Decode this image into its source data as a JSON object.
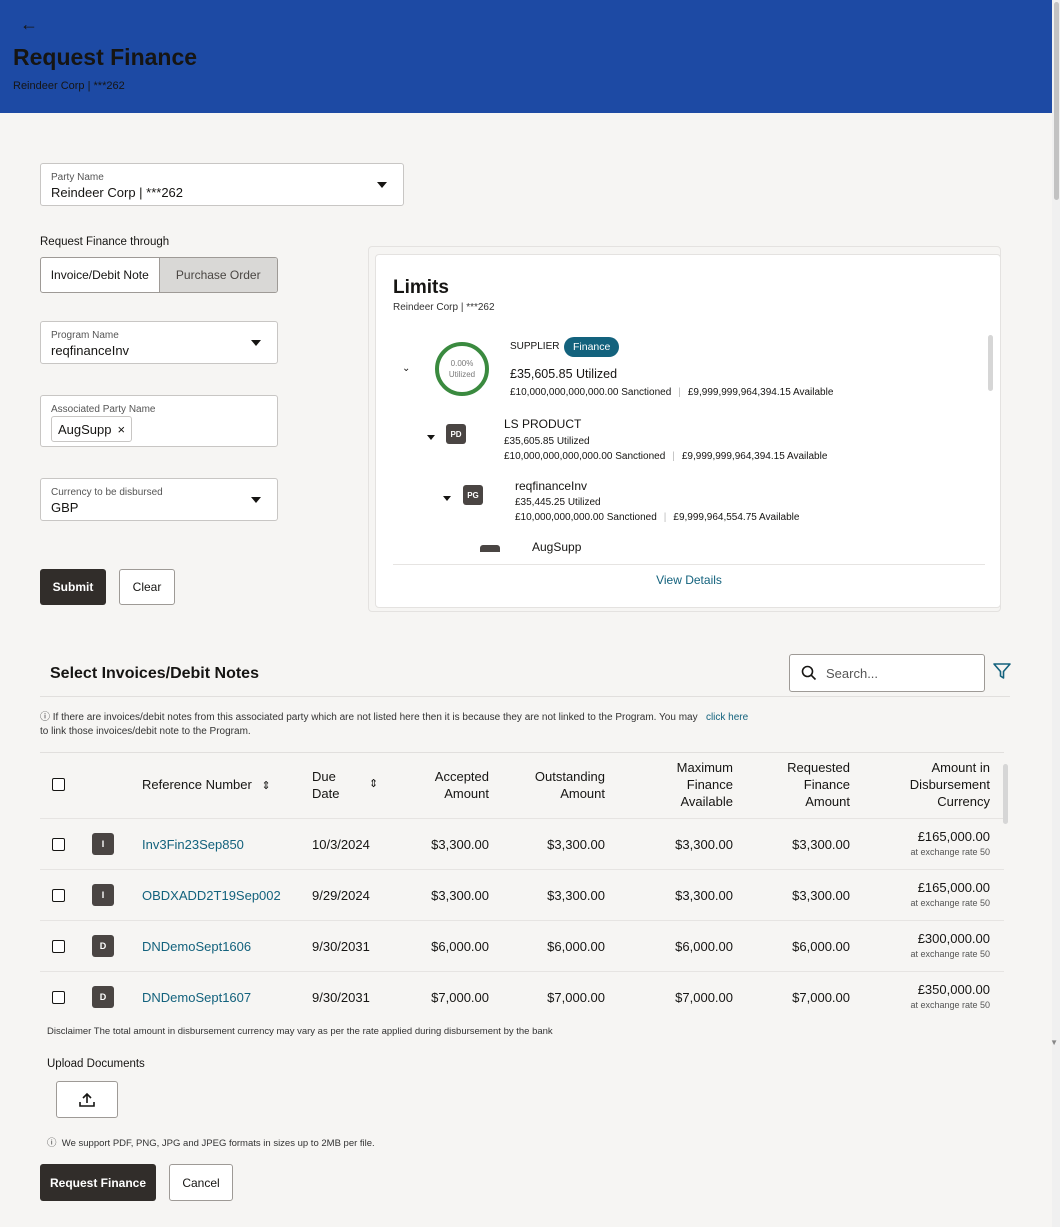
{
  "header": {
    "back_icon": "arrow-left-icon",
    "title": "Request Finance",
    "subtitle": "Reindeer Corp | ***262"
  },
  "form": {
    "party_name": {
      "label": "Party Name",
      "value": "Reindeer Corp | ***262"
    },
    "request_through": {
      "label": "Request Finance through",
      "options": [
        "Invoice/Debit Note",
        "Purchase Order"
      ],
      "selected": "Invoice/Debit Note"
    },
    "program_name": {
      "label": "Program Name",
      "value": "reqfinanceInv"
    },
    "associated_party": {
      "label": "Associated Party Name",
      "chip": "AugSupp",
      "chip_remove": "×"
    },
    "currency": {
      "label": "Currency to be disbursed",
      "value": "GBP"
    },
    "submit_label": "Submit",
    "clear_label": "Clear"
  },
  "limits": {
    "title": "Limits",
    "subtitle": "Reindeer Corp | ***262",
    "supplier": {
      "label": "SUPPLIER",
      "badge": "Finance",
      "ring_percent": "0.00%",
      "ring_label": "Utilized",
      "utilized": "£35,605.85 Utilized",
      "sanctioned": "£10,000,000,000,000.00 Sanctioned",
      "available": "£9,999,999,964,394.15 Available"
    },
    "product": {
      "tag": "PD",
      "name": "LS PRODUCT",
      "utilized": "£35,605.85 Utilized",
      "sanctioned": "£10,000,000,000,000.00 Sanctioned",
      "available": "£9,999,999,964,394.15 Available"
    },
    "program": {
      "tag": "PG",
      "name": "reqfinanceInv",
      "utilized": "£35,445.25 Utilized",
      "sanctioned": "£10,000,000,000.00 Sanctioned",
      "available": "£9,999,964,554.75 Available"
    },
    "party": {
      "name": "AugSupp"
    },
    "view_details": "View Details"
  },
  "invoices": {
    "title": "Select Invoices/Debit Notes",
    "search_placeholder": "Search...",
    "info_text": "If there are invoices/debit notes from this associated party which are not listed here then it is because they are not linked to the Program. You may",
    "info_link": "click here",
    "info_text_2": "to link those invoices/debit note to the Program.",
    "columns": {
      "reference": "Reference Number",
      "due_date_1": "Due",
      "due_date_2": "Date",
      "accepted_1": "Accepted",
      "accepted_2": "Amount",
      "outstanding_1": "Outstanding",
      "outstanding_2": "Amount",
      "max_1": "Maximum",
      "max_2": "Finance",
      "max_3": "Available",
      "requested_1": "Requested",
      "requested_2": "Finance",
      "requested_3": "Amount",
      "disb_1": "Amount in",
      "disb_2": "Disbursement",
      "disb_3": "Currency"
    },
    "rows": [
      {
        "type": "I",
        "ref": "Inv3Fin23Sep850",
        "due": "10/3/2024",
        "accepted": "$3,300.00",
        "outstanding": "$3,300.00",
        "max": "$3,300.00",
        "requested": "$3,300.00",
        "disb": "£165,000.00",
        "rate": "at exchange rate 50"
      },
      {
        "type": "I",
        "ref": "OBDXADD2T19Sep002",
        "due": "9/29/2024",
        "accepted": "$3,300.00",
        "outstanding": "$3,300.00",
        "max": "$3,300.00",
        "requested": "$3,300.00",
        "disb": "£165,000.00",
        "rate": "at exchange rate 50"
      },
      {
        "type": "D",
        "ref": "DNDemoSept1606",
        "due": "9/30/2031",
        "accepted": "$6,000.00",
        "outstanding": "$6,000.00",
        "max": "$6,000.00",
        "requested": "$6,000.00",
        "disb": "£300,000.00",
        "rate": "at exchange rate 50"
      },
      {
        "type": "D",
        "ref": "DNDemoSept1607",
        "due": "9/30/2031",
        "accepted": "$7,000.00",
        "outstanding": "$7,000.00",
        "max": "$7,000.00",
        "requested": "$7,000.00",
        "disb": "£350,000.00",
        "rate": "at exchange rate 50"
      }
    ],
    "disclaimer": "Disclaimer  The total amount in disbursement currency may vary as per the rate applied during disbursement by the bank"
  },
  "upload": {
    "label": "Upload Documents",
    "support_text": "We support PDF, PNG, JPG and JPEG formats in sizes up to 2MB per file."
  },
  "actions": {
    "request_label": "Request Finance",
    "cancel_label": "Cancel"
  },
  "colors": {
    "header_bg": "#1d4aa4",
    "link": "#13627d",
    "dark_button": "#312d2a",
    "ring": "#3a8a3f"
  }
}
